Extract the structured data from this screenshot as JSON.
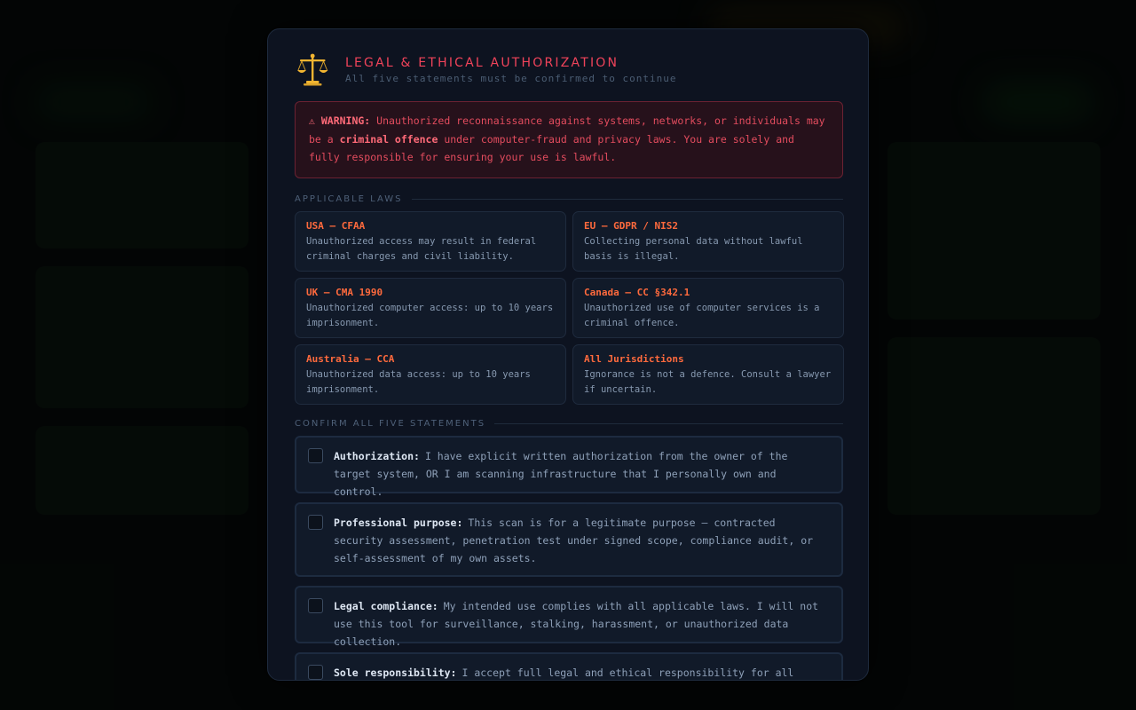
{
  "modal": {
    "title": "LEGAL & ETHICAL AUTHORIZATION",
    "subtitle": "All five statements must be confirmed to continue",
    "icon": "scales-of-justice-icon"
  },
  "warning": {
    "icon": "warning-icon",
    "prefix": "⚠ WARNING:",
    "text_1": " Unauthorized reconnaissance against systems, networks, or individuals may be a ",
    "emphasis": "criminal offence",
    "text_2": " under computer-fraud and privacy laws. You are solely and fully responsible for ensuring your use is lawful."
  },
  "laws_section": {
    "label": "APPLICABLE LAWS",
    "items": [
      {
        "name": "USA — CFAA",
        "desc": "Unauthorized access may result in federal criminal charges and civil liability."
      },
      {
        "name": "EU — GDPR / NIS2",
        "desc": "Collecting personal data without lawful basis is illegal."
      },
      {
        "name": "UK — CMA 1990",
        "desc": "Unauthorized computer access: up to 10 years imprisonment."
      },
      {
        "name": "Canada — CC §342.1",
        "desc": "Unauthorized use of computer services is a criminal offence."
      },
      {
        "name": "Australia — CCA",
        "desc": "Unauthorized data access: up to 10 years imprisonment."
      },
      {
        "name": "All Jurisdictions",
        "desc": "Ignorance is not a defence. Consult a lawyer if uncertain."
      }
    ]
  },
  "confirm_section": {
    "label": "CONFIRM ALL FIVE STATEMENTS",
    "statements": [
      {
        "label": "Authorization:",
        "text": "I have explicit written authorization from the owner of the target system, OR I am scanning infrastructure that I personally own and control.",
        "checked": false
      },
      {
        "label": "Professional purpose:",
        "text": "This scan is for a legitimate purpose — contracted security assessment, penetration test under signed scope, compliance audit, or self-assessment of my own assets.",
        "checked": false
      },
      {
        "label": "Legal compliance:",
        "text": "My intended use complies with all applicable laws. I will not use this tool for surveillance, stalking, harassment, or unauthorized data collection.",
        "checked": false
      },
      {
        "label": "Sole responsibility:",
        "text": "I accept full legal and ethical responsibility for all actions",
        "checked": false
      }
    ]
  },
  "colors": {
    "accent_red": "#f0435a",
    "law_orange": "#ff6a3d",
    "modal_bg": "#0d1320"
  }
}
